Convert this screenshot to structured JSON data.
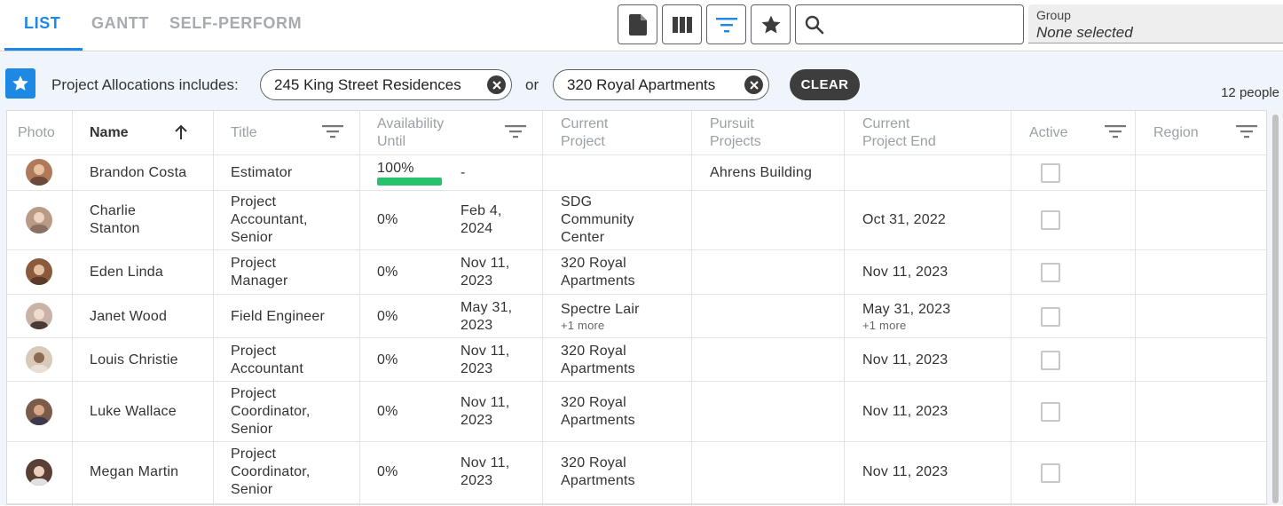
{
  "tabs": [
    {
      "label": "LIST",
      "active": true
    },
    {
      "label": "GANTT",
      "active": false
    },
    {
      "label": "SELF-PERFORM",
      "active": false
    }
  ],
  "toolbar": {
    "icons": [
      "document-icon",
      "columns-icon",
      "filter-icon",
      "star-icon"
    ],
    "search": {
      "value": "",
      "placeholder": ""
    }
  },
  "group": {
    "label": "Group",
    "value": "None selected"
  },
  "filter": {
    "label": "Project Allocations includes:",
    "chips": [
      "245 King Street Residences",
      "320 Royal Apartments"
    ],
    "joiner": "or",
    "clear_label": "CLEAR",
    "count": "12 people"
  },
  "columns": {
    "photo": "Photo",
    "name": "Name",
    "title": "Title",
    "availability_1": "Availability",
    "availability_2": "Until",
    "current_project_1": "Current",
    "current_project_2": "Project",
    "pursuit_1": "Pursuit",
    "pursuit_2": "Projects",
    "project_end_1": "Current",
    "project_end_2": "Project End",
    "active": "Active",
    "region": "Region"
  },
  "rows": [
    {
      "name": [
        "Brandon Costa"
      ],
      "title": [
        "Estimator"
      ],
      "availability": "100%",
      "availability_fraction": 1.0,
      "until": [
        "-"
      ],
      "project": [
        "",
        ""
      ],
      "project_more": "",
      "pursuit": "Ahrens Building",
      "end": "",
      "end_more": "",
      "active": false,
      "avatar_color": "#b07a5a"
    },
    {
      "name": [
        "Charlie",
        "Stanton"
      ],
      "title": [
        "Project",
        "Accountant,",
        "Senior"
      ],
      "availability": "0%",
      "availability_fraction": 0,
      "until": [
        "Feb 4,",
        "2024"
      ],
      "project": [
        "SDG",
        "Community",
        "Center"
      ],
      "project_more": "",
      "pursuit": "",
      "end": "Oct 31, 2022",
      "end_more": "",
      "active": false,
      "avatar_color": "#b89a86"
    },
    {
      "name": [
        "Eden Linda"
      ],
      "title": [
        "Project",
        "Manager"
      ],
      "availability": "0%",
      "availability_fraction": 0,
      "until": [
        "Nov 11,",
        "2023"
      ],
      "project": [
        "320 Royal",
        "Apartments"
      ],
      "project_more": "",
      "pursuit": "",
      "end": "Nov 11, 2023",
      "end_more": "",
      "active": false,
      "avatar_color": "#8a5a3c"
    },
    {
      "name": [
        "Janet Wood"
      ],
      "title": [
        "Field Engineer"
      ],
      "availability": "0%",
      "availability_fraction": 0,
      "until": [
        "May 31,",
        "2023"
      ],
      "project": [
        "Spectre Lair"
      ],
      "project_more": "+1 more",
      "pursuit": "",
      "end": "May 31, 2023",
      "end_more": "+1 more",
      "active": false,
      "avatar_color": "#c9b2a6"
    },
    {
      "name": [
        "Louis Christie"
      ],
      "title": [
        "Project",
        "Accountant"
      ],
      "availability": "0%",
      "availability_fraction": 0,
      "until": [
        "Nov 11,",
        "2023"
      ],
      "project": [
        "320 Royal",
        "Apartments"
      ],
      "project_more": "",
      "pursuit": "",
      "end": "Nov 11, 2023",
      "end_more": "",
      "active": false,
      "avatar_color": "#d8c9b8"
    },
    {
      "name": [
        "Luke Wallace"
      ],
      "title": [
        "Project",
        "Coordinator,",
        "Senior"
      ],
      "availability": "0%",
      "availability_fraction": 0,
      "until": [
        "Nov 11,",
        "2023"
      ],
      "project": [
        "320 Royal",
        "Apartments"
      ],
      "project_more": "",
      "pursuit": "",
      "end": "Nov 11, 2023",
      "end_more": "",
      "active": false,
      "avatar_color": "#7a5a48"
    },
    {
      "name": [
        "Megan Martin"
      ],
      "title": [
        "Project",
        "Coordinator,",
        "Senior"
      ],
      "availability": "0%",
      "availability_fraction": 0,
      "until": [
        "Nov 11,",
        "2023"
      ],
      "project": [
        "320 Royal",
        "Apartments"
      ],
      "project_more": "",
      "pursuit": "",
      "end": "Nov 11, 2023",
      "end_more": "",
      "active": false,
      "avatar_color": "#5a4034"
    }
  ],
  "colors": {
    "accent": "#1e88e5",
    "progress": "#27c36c",
    "chip_close": "#3c3c3c",
    "clear_bg": "#3d3d3d"
  }
}
